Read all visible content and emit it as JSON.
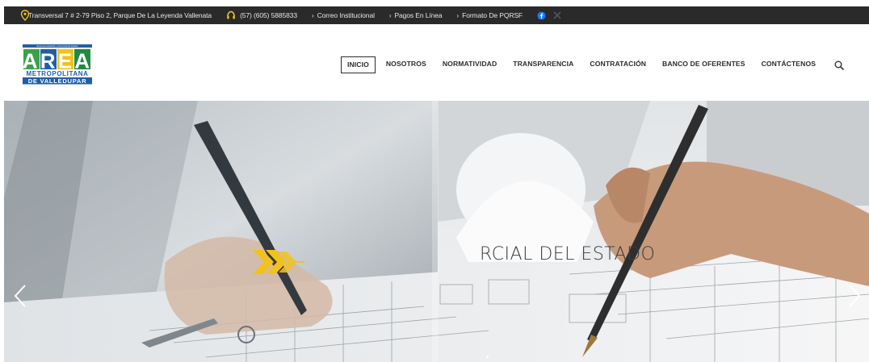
{
  "topbar": {
    "address": "Transversal 7 # 2-79 Piso 2, Parque De La Leyenda Vallenata",
    "phone": "(57) (605) 5885833",
    "links": [
      {
        "label": "Correo Institucional"
      },
      {
        "label": "Pagos En Línea"
      },
      {
        "label": "Formato De PQRSF"
      }
    ]
  },
  "logo": {
    "tagline": "Empresa Industrial y Comercial del Estado",
    "word": "AREA",
    "line1": "METROPOLITANA",
    "line2": "DE VALLEDUPAR"
  },
  "nav": {
    "items": [
      {
        "label": "INICIO"
      },
      {
        "label": "NOSOTROS"
      },
      {
        "label": "NORMATIVIDAD"
      },
      {
        "label": "TRANSPARENCIA"
      },
      {
        "label": "CONTRATACIÓN"
      },
      {
        "label": "BANCO DE OFERENTES"
      },
      {
        "label": "CONTÁCTENOS"
      }
    ]
  },
  "hero": {
    "caption": "RCIAL DEL ESTADO"
  },
  "colors": {
    "topbar_bg": "#2a2a2a",
    "accent_yellow": "#f2c21b",
    "accent_green": "#3aa14a",
    "accent_blue": "#1f5fa8"
  },
  "icons": [
    "location-pin-icon",
    "phone-icon",
    "facebook-icon",
    "x-icon",
    "search-icon",
    "chevron-left-icon",
    "chevron-right-icon"
  ]
}
